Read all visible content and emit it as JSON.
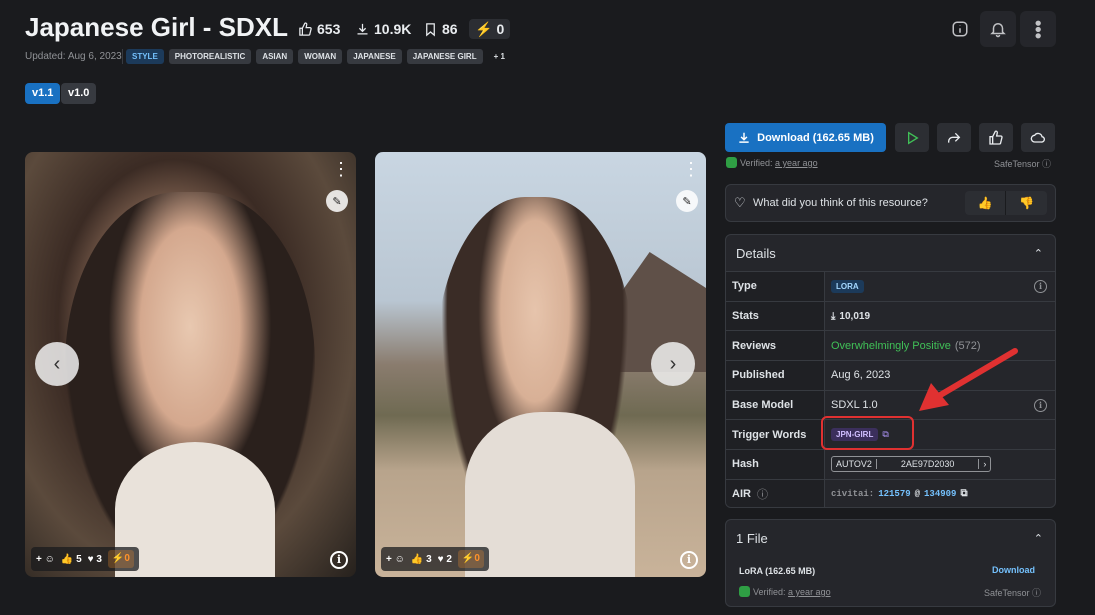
{
  "header": {
    "title": "Japanese Girl - SDXL",
    "likes": "653",
    "downloads": "10.9K",
    "bookmarks": "86",
    "buzz": "0",
    "updated": "Updated: Aug 6, 2023",
    "tags": [
      "STYLE",
      "PHOTOREALISTIC",
      "ASIAN",
      "WOMAN",
      "JAPANESE",
      "JAPANESE GIRL",
      "+ 1"
    ]
  },
  "versions": [
    "v1.1",
    "v1.0"
  ],
  "gallery": [
    {
      "thumbs": "5",
      "hearts": "3",
      "buzz": "0"
    },
    {
      "thumbs": "3",
      "hearts": "2",
      "buzz": "0"
    }
  ],
  "sidebar": {
    "download_label": "Download (162.65 MB)",
    "verified_prefix": "Verified:",
    "verified_when": "a year ago",
    "safetensor": "SafeTensor",
    "feedback_question": "What did you think of this resource?"
  },
  "details": {
    "title": "Details",
    "rows": [
      {
        "k": "Type",
        "v": "LORA"
      },
      {
        "k": "Stats",
        "v": "10,019"
      },
      {
        "k": "Reviews",
        "v": "Overwhelmingly Positive",
        "v2": "(572)"
      },
      {
        "k": "Published",
        "v": "Aug 6, 2023"
      },
      {
        "k": "Base Model",
        "v": "SDXL 1.0"
      },
      {
        "k": "Trigger Words",
        "v": "JPN-GIRL"
      },
      {
        "k": "Hash",
        "v": "AUTOV2",
        "v2": "2AE97D2030"
      },
      {
        "k": "AIR",
        "v": "civitai:",
        "v2": "121579",
        "v3": "@",
        "v4": "134909"
      }
    ]
  },
  "files": {
    "title": "1 File",
    "name": "LoRA (162.65 MB)",
    "download": "Download",
    "verified_prefix": "Verified:",
    "verified_when": "a year ago",
    "format": "SafeTensor"
  },
  "colors": {
    "accent": "#1971c2",
    "positive": "#40c057",
    "annotation": "#e03131"
  }
}
